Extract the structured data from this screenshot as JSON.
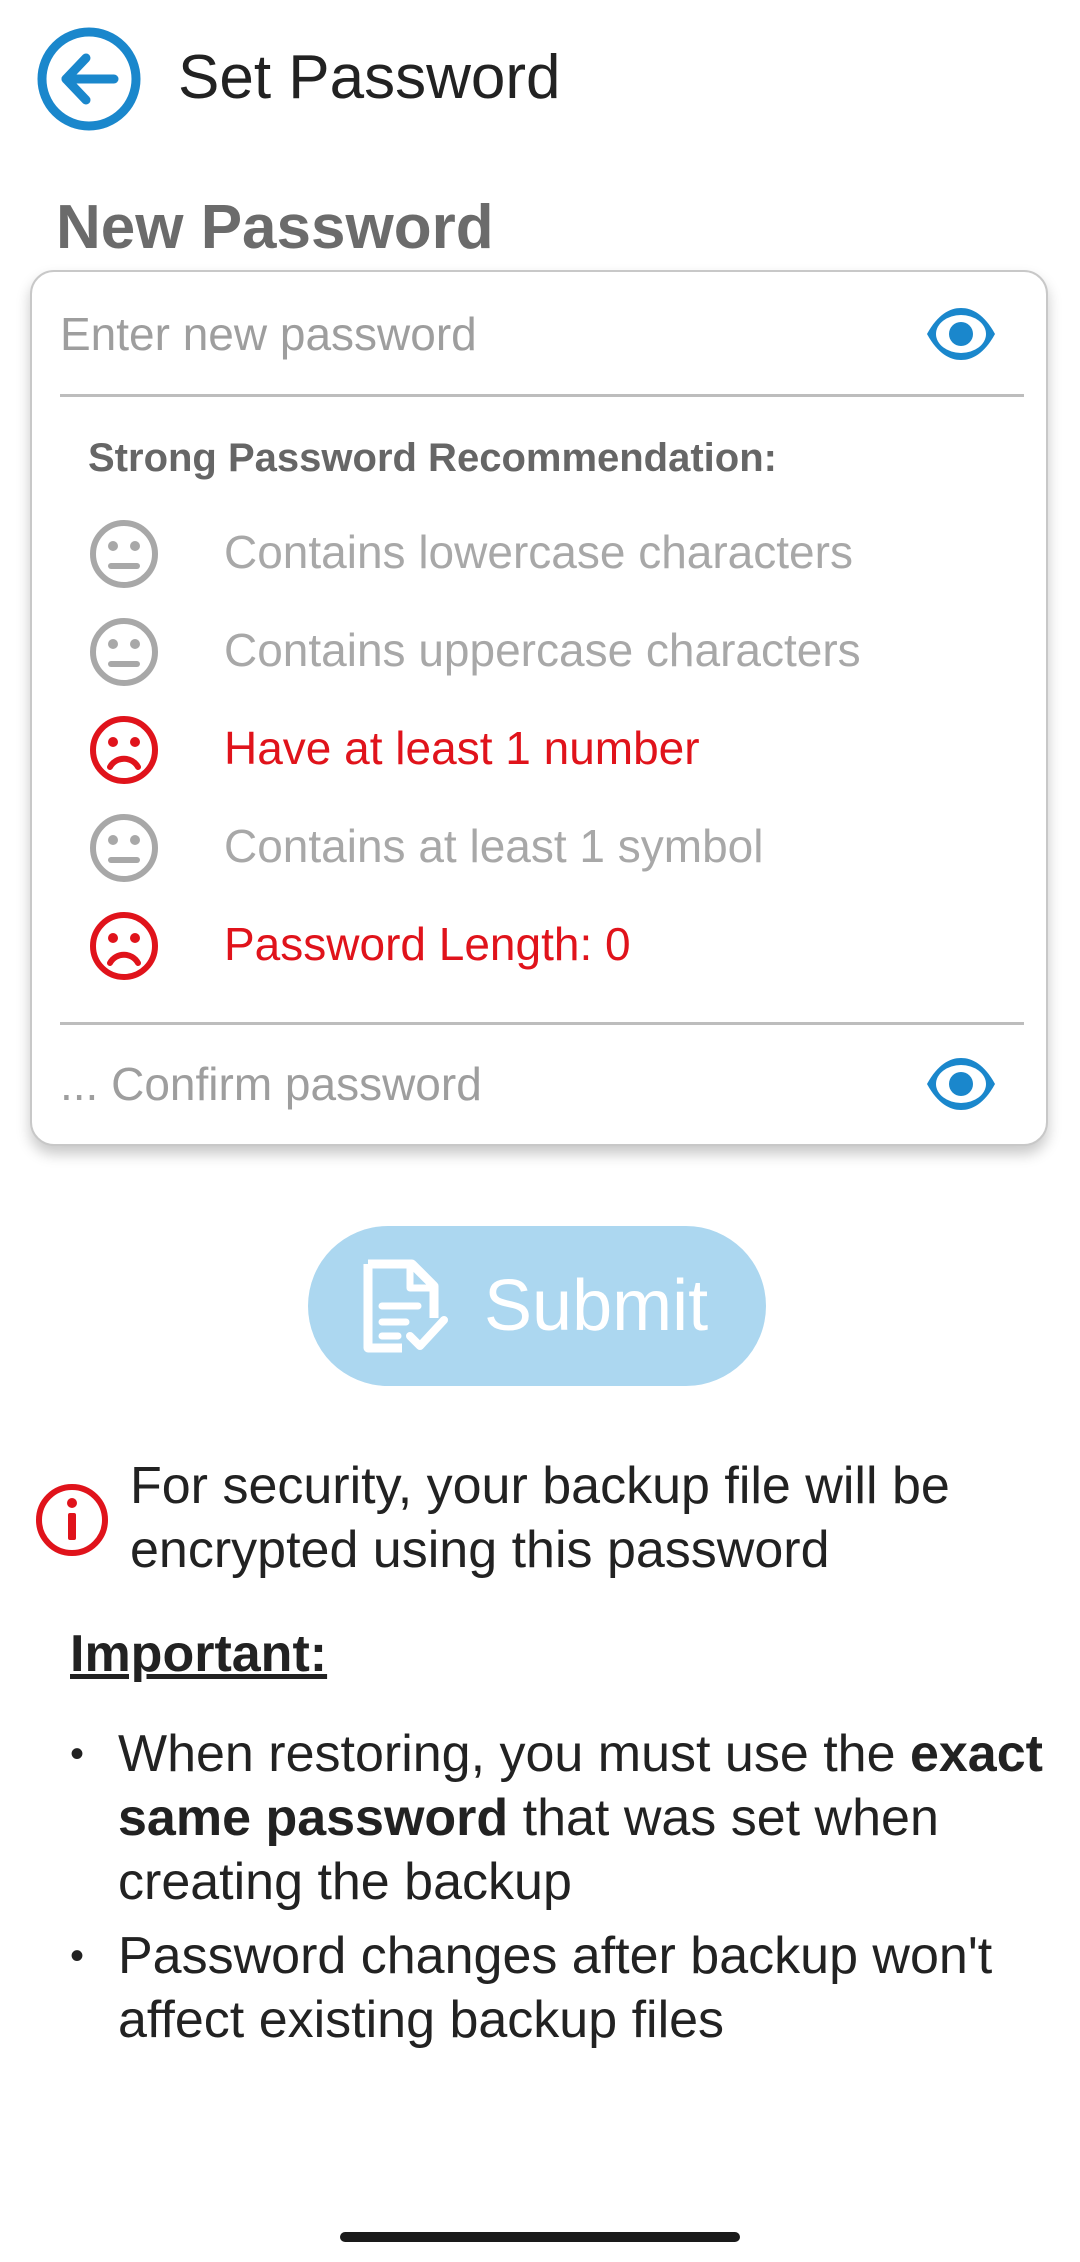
{
  "header": {
    "title": "Set Password",
    "back_icon": "arrow-left-circle-icon"
  },
  "form": {
    "section_label": "New Password",
    "new_password": {
      "value": "",
      "placeholder": "Enter new password",
      "toggle_icon": "eye-icon"
    },
    "confirm_password": {
      "value": "",
      "placeholder": "... Confirm password",
      "toggle_icon": "eye-icon"
    },
    "recommendation_title": "Strong Password Recommendation:",
    "recommendations": [
      {
        "label": "Contains lowercase characters",
        "status": "neutral",
        "icon": "neutral-face-icon"
      },
      {
        "label": "Contains uppercase characters",
        "status": "neutral",
        "icon": "neutral-face-icon"
      },
      {
        "label": "Have at least 1 number",
        "status": "fail",
        "icon": "sad-face-icon"
      },
      {
        "label": "Contains at least 1 symbol",
        "status": "neutral",
        "icon": "neutral-face-icon"
      },
      {
        "label": "Password Length: 0",
        "status": "fail",
        "icon": "sad-face-icon"
      }
    ]
  },
  "submit": {
    "label": "Submit",
    "icon": "document-check-icon",
    "enabled": false
  },
  "info": {
    "icon": "info-circle-icon",
    "text": "For security, your backup file will be encrypted using this password"
  },
  "important": {
    "title": "Important:",
    "items": [
      {
        "before": "When restoring, you must use the ",
        "bold": "exact same password",
        "after": " that was set when creating the backup"
      },
      {
        "before": "Password changes after backup won't affect existing backup files",
        "bold": "",
        "after": ""
      }
    ]
  },
  "colors": {
    "accent": "#1a87cc",
    "error": "#e0131b",
    "neutral": "#a8a8a8",
    "submit_disabled": "#acd7f0"
  }
}
